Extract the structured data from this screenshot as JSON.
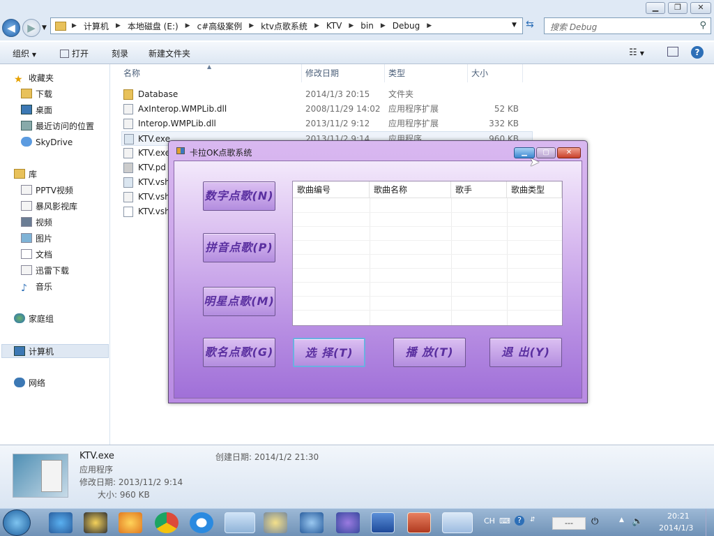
{
  "address": {
    "crumbs": [
      "计算机",
      "本地磁盘 (E:)",
      "c#高级案例",
      "ktv点歌系统",
      "KTV",
      "bin",
      "Debug"
    ]
  },
  "search": {
    "placeholder": "搜索 Debug"
  },
  "toolbar": {
    "organize": "组织",
    "open": "打开",
    "burn": "刻录",
    "new_folder": "新建文件夹"
  },
  "sidebar": {
    "favorites": "收藏夹",
    "downloads": "下载",
    "desktop": "桌面",
    "recent": "最近访问的位置",
    "skydrive": "SkyDrive",
    "library": "库",
    "pptv": "PPTV视频",
    "storm": "暴风影视库",
    "video": "视频",
    "pictures": "图片",
    "docs": "文档",
    "xunlei": "迅雷下载",
    "music": "音乐",
    "homegroup": "家庭组",
    "computer": "计算机",
    "network": "网络"
  },
  "columns": {
    "name": "名称",
    "date": "修改日期",
    "type": "类型",
    "size": "大小"
  },
  "files": [
    {
      "name": "Database",
      "date": "2014/1/3 20:15",
      "type": "文件夹",
      "size": ""
    },
    {
      "name": "AxInterop.WMPLib.dll",
      "date": "2008/11/29 14:02",
      "type": "应用程序扩展",
      "size": "52 KB"
    },
    {
      "name": "Interop.WMPLib.dll",
      "date": "2013/11/2 9:12",
      "type": "应用程序扩展",
      "size": "332 KB"
    },
    {
      "name": "KTV.exe",
      "date": "2013/11/2 9:14",
      "type": "应用程序",
      "size": "960 KB"
    },
    {
      "name": "KTV.exe",
      "date": "",
      "type": "",
      "size": ""
    },
    {
      "name": "KTV.pd",
      "date": "",
      "type": "",
      "size": ""
    },
    {
      "name": "KTV.vsh",
      "date": "",
      "type": "",
      "size": ""
    },
    {
      "name": "KTV.vsh",
      "date": "",
      "type": "",
      "size": ""
    },
    {
      "name": "KTV.vsh",
      "date": "",
      "type": "",
      "size": ""
    }
  ],
  "details": {
    "filename": "KTV.exe",
    "filetype": "应用程序",
    "modified": "修改日期: 2013/11/2 9:14",
    "size": "大小: 960 KB",
    "created": "创建日期: 2014/1/2 21:30"
  },
  "dialog": {
    "title": "卡拉OK点歌系统",
    "btn_number": "数字点歌(N)",
    "btn_pinyin": "拼音点歌(P)",
    "btn_star": "明星点歌(M)",
    "btn_name": "歌名点歌(G)",
    "btn_select": "选 择(T)",
    "btn_play": "播 放(T)",
    "btn_exit": "退 出(Y)",
    "grid_headers": [
      "歌曲编号",
      "歌曲名称",
      "歌手",
      "歌曲类型"
    ]
  },
  "taskbar": {
    "lang": "CH",
    "time": "20:21",
    "date": "2014/1/3",
    "tray_box": "---"
  }
}
